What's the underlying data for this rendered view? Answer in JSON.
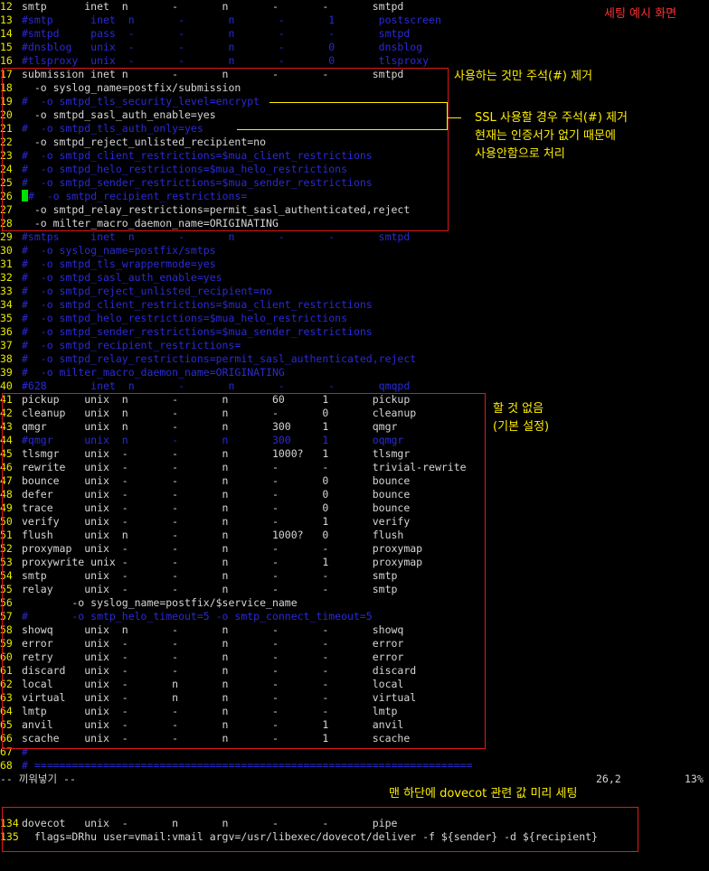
{
  "title_note": "세팅 예시 화면",
  "annotations": {
    "submission": "사용하는 것만 주석(#) 제거",
    "ssl_line1": "SSL 사용할 경우 주석(#) 제거",
    "ssl_line2": "현재는 인증서가 없기 때문에",
    "ssl_line3": "사용안함으로 처리",
    "nothing_line1": "할 것 없음",
    "nothing_line2": "(기본 설정)",
    "bottom": "맨 하단에 dovecot 관련 값 미리 세팅"
  },
  "lines": [
    {
      "n": "12",
      "t": "smtp      inet  n       -       n       -       -       smtpd",
      "c": false
    },
    {
      "n": "13",
      "t": "#smtp      inet  n       -       n       -       1       postscreen",
      "c": true
    },
    {
      "n": "14",
      "t": "#smtpd     pass  -       -       n       -       -       smtpd",
      "c": true
    },
    {
      "n": "15",
      "t": "#dnsblog   unix  -       -       n       -       0       dnsblog",
      "c": true
    },
    {
      "n": "16",
      "t": "#tlsproxy  unix  -       -       n       -       0       tlsproxy",
      "c": true
    },
    {
      "n": "17",
      "t": "submission inet n       -       n       -       -       smtpd",
      "c": false
    },
    {
      "n": "18",
      "t": "  -o syslog_name=postfix/submission",
      "c": false
    },
    {
      "n": "19",
      "t": "#  -o smtpd_tls_security_level=encrypt",
      "c": true
    },
    {
      "n": "20",
      "t": "  -o smtpd_sasl_auth_enable=yes",
      "c": false
    },
    {
      "n": "21",
      "t": "#  -o smtpd_tls_auth_only=yes",
      "c": true
    },
    {
      "n": "22",
      "t": "  -o smtpd_reject_unlisted_recipient=no",
      "c": false
    },
    {
      "n": "23",
      "t": "#  -o smtpd_client_restrictions=$mua_client_restrictions",
      "c": true
    },
    {
      "n": "24",
      "t": "#  -o smtpd_helo_restrictions=$mua_helo_restrictions",
      "c": true
    },
    {
      "n": "25",
      "t": "#  -o smtpd_sender_restrictions=$mua_sender_restrictions",
      "c": true
    },
    {
      "n": "26",
      "t": "#  -o smtpd_recipient_restrictions=",
      "c": true,
      "cursor": true
    },
    {
      "n": "27",
      "t": "  -o smtpd_relay_restrictions=permit_sasl_authenticated,reject",
      "c": false
    },
    {
      "n": "28",
      "t": "  -o milter_macro_daemon_name=ORIGINATING",
      "c": false
    },
    {
      "n": "29",
      "t": "#smtps     inet  n       -       n       -       -       smtpd",
      "c": true
    },
    {
      "n": "30",
      "t": "#  -o syslog_name=postfix/smtps",
      "c": true
    },
    {
      "n": "31",
      "t": "#  -o smtpd_tls_wrappermode=yes",
      "c": true
    },
    {
      "n": "32",
      "t": "#  -o smtpd_sasl_auth_enable=yes",
      "c": true
    },
    {
      "n": "33",
      "t": "#  -o smtpd_reject_unlisted_recipient=no",
      "c": true
    },
    {
      "n": "34",
      "t": "#  -o smtpd_client_restrictions=$mua_client_restrictions",
      "c": true
    },
    {
      "n": "35",
      "t": "#  -o smtpd_helo_restrictions=$mua_helo_restrictions",
      "c": true
    },
    {
      "n": "36",
      "t": "#  -o smtpd_sender_restrictions=$mua_sender_restrictions",
      "c": true
    },
    {
      "n": "37",
      "t": "#  -o smtpd_recipient_restrictions=",
      "c": true
    },
    {
      "n": "38",
      "t": "#  -o smtpd_relay_restrictions=permit_sasl_authenticated,reject",
      "c": true
    },
    {
      "n": "39",
      "t": "#  -o milter_macro_daemon_name=ORIGINATING",
      "c": true
    },
    {
      "n": "40",
      "t": "#628       inet  n       -       n       -       -       qmqpd",
      "c": true
    },
    {
      "n": "41",
      "t": "pickup    unix  n       -       n       60      1       pickup",
      "c": false
    },
    {
      "n": "42",
      "t": "cleanup   unix  n       -       n       -       0       cleanup",
      "c": false
    },
    {
      "n": "43",
      "t": "qmgr      unix  n       -       n       300     1       qmgr",
      "c": false
    },
    {
      "n": "44",
      "t": "#qmgr     unix  n       -       n       300     1       oqmgr",
      "c": true
    },
    {
      "n": "45",
      "t": "tlsmgr    unix  -       -       n       1000?   1       tlsmgr",
      "c": false
    },
    {
      "n": "46",
      "t": "rewrite   unix  -       -       n       -       -       trivial-rewrite",
      "c": false
    },
    {
      "n": "47",
      "t": "bounce    unix  -       -       n       -       0       bounce",
      "c": false
    },
    {
      "n": "48",
      "t": "defer     unix  -       -       n       -       0       bounce",
      "c": false
    },
    {
      "n": "49",
      "t": "trace     unix  -       -       n       -       0       bounce",
      "c": false
    },
    {
      "n": "50",
      "t": "verify    unix  -       -       n       -       1       verify",
      "c": false
    },
    {
      "n": "51",
      "t": "flush     unix  n       -       n       1000?   0       flush",
      "c": false
    },
    {
      "n": "52",
      "t": "proxymap  unix  -       -       n       -       -       proxymap",
      "c": false
    },
    {
      "n": "53",
      "t": "proxywrite unix -       -       n       -       1       proxymap",
      "c": false
    },
    {
      "n": "54",
      "t": "smtp      unix  -       -       n       -       -       smtp",
      "c": false
    },
    {
      "n": "55",
      "t": "relay     unix  -       -       n       -       -       smtp",
      "c": false
    },
    {
      "n": "56",
      "t": "        -o syslog_name=postfix/$service_name",
      "c": false
    },
    {
      "n": "57",
      "t": "#       -o smtp_helo_timeout=5 -o smtp_connect_timeout=5",
      "c": true
    },
    {
      "n": "58",
      "t": "showq     unix  n       -       n       -       -       showq",
      "c": false
    },
    {
      "n": "59",
      "t": "error     unix  -       -       n       -       -       error",
      "c": false
    },
    {
      "n": "60",
      "t": "retry     unix  -       -       n       -       -       error",
      "c": false
    },
    {
      "n": "61",
      "t": "discard   unix  -       -       n       -       -       discard",
      "c": false
    },
    {
      "n": "62",
      "t": "local     unix  -       n       n       -       -       local",
      "c": false
    },
    {
      "n": "63",
      "t": "virtual   unix  -       n       n       -       -       virtual",
      "c": false
    },
    {
      "n": "64",
      "t": "lmtp      unix  -       -       n       -       -       lmtp",
      "c": false
    },
    {
      "n": "65",
      "t": "anvil     unix  -       -       n       -       1       anvil",
      "c": false
    },
    {
      "n": "66",
      "t": "scache    unix  -       -       n       -       1       scache",
      "c": false
    },
    {
      "n": "67",
      "t": "#",
      "c": true
    },
    {
      "n": "68",
      "t": "# ======================================================================",
      "c": true
    }
  ],
  "status": {
    "mode": "-- 끼워넣기 --",
    "position": "26,2",
    "percent": "13%"
  },
  "bottom_lines": [
    {
      "n": "134",
      "t": "dovecot   unix  -       n       n       -       -       pipe",
      "c": false
    },
    {
      "n": "135",
      "t": "  flags=DRhu user=vmail:vmail argv=/usr/libexec/dovecot/deliver -f ${sender} -d ${recipient}",
      "c": false
    }
  ]
}
